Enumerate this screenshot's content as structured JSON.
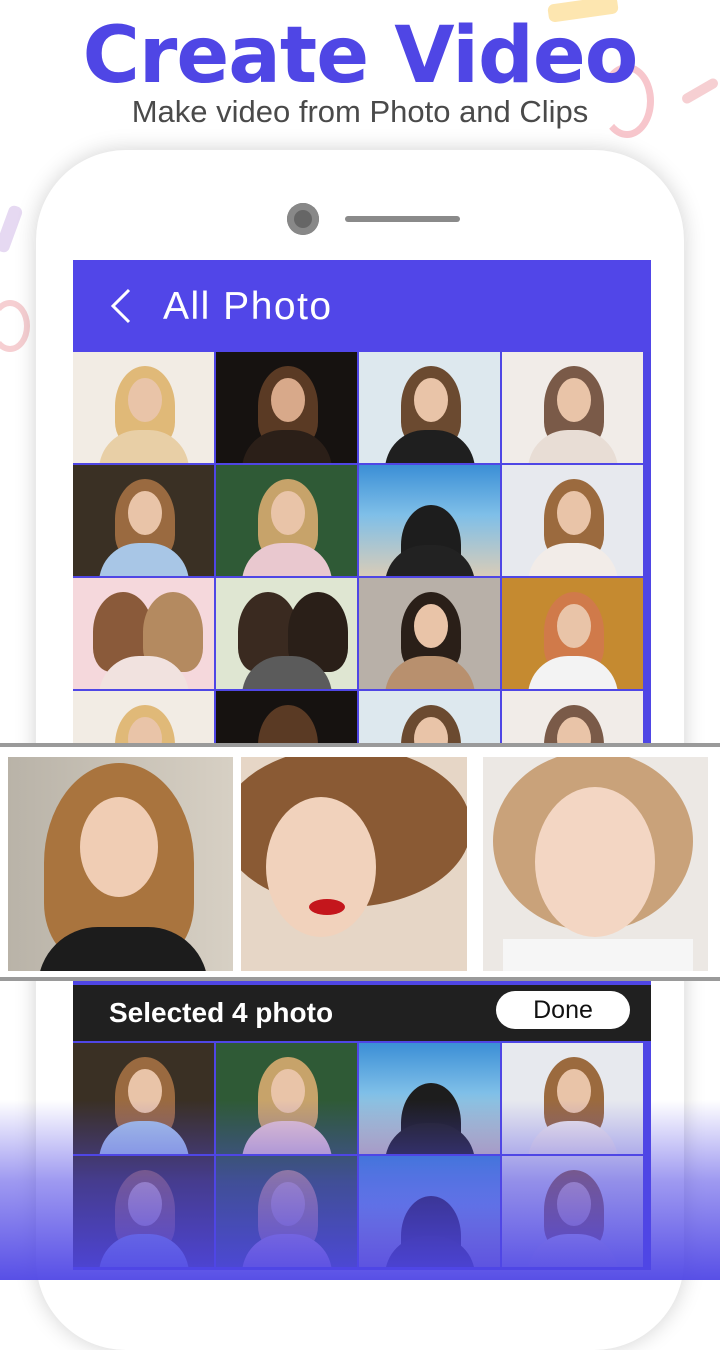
{
  "promo": {
    "title": "Create Video",
    "subtitle": "Make video from Photo and Clips"
  },
  "app": {
    "header_title": "All Photo",
    "selected_text": "Selected 4 photo",
    "done_label": "Done"
  },
  "colors": {
    "accent": "#4f46e5",
    "header": "#5146e8",
    "select_bar": "#202020"
  },
  "icons": {
    "back": "chevron-left-icon"
  }
}
